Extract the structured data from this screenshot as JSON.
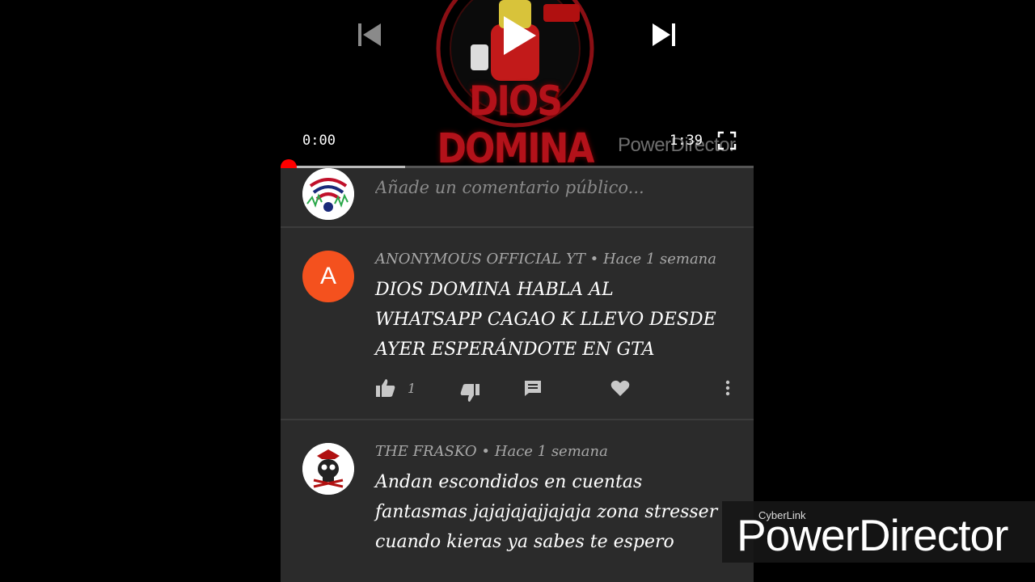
{
  "player": {
    "current_time": "0:00",
    "total_time": "1:39",
    "overlay_watermark": "PowerDirector",
    "video_logo_text": "DIOS DOMINA",
    "progress_fraction": 0.25,
    "played_fraction": 0.0,
    "icons": {
      "prev": "skip-previous-icon",
      "play": "play-icon",
      "next": "skip-next-icon",
      "fullscreen": "fullscreen-icon"
    }
  },
  "comment_box": {
    "placeholder": "Añade un comentario público..."
  },
  "comments": [
    {
      "author": "ANONYMOUS OFFICIAL YT",
      "separator": "•",
      "time": "Hace 1 semana",
      "avatar_letter": "A",
      "avatar_color": "#f4511e",
      "text": "DIOS DOMINA HABLA AL WHATSAPP CAGAO K LLEVO DESDE AYER ESPERÁNDOTE EN GTA",
      "likes": "1"
    },
    {
      "author": "THE FRASKO",
      "separator": "•",
      "time": "Hace 1 semana",
      "text": "Andan escondidos en cuentas fantasmas jajajajajjajaja zona stresser cuando kieras ya sabes te espero"
    }
  ],
  "watermark": {
    "brand_small": "CyberLink",
    "brand_large": "PowerDirector"
  },
  "colors": {
    "panel_bg": "#2b2b2b",
    "progress_red": "#ff0000",
    "avatar_orange": "#f4511e"
  }
}
